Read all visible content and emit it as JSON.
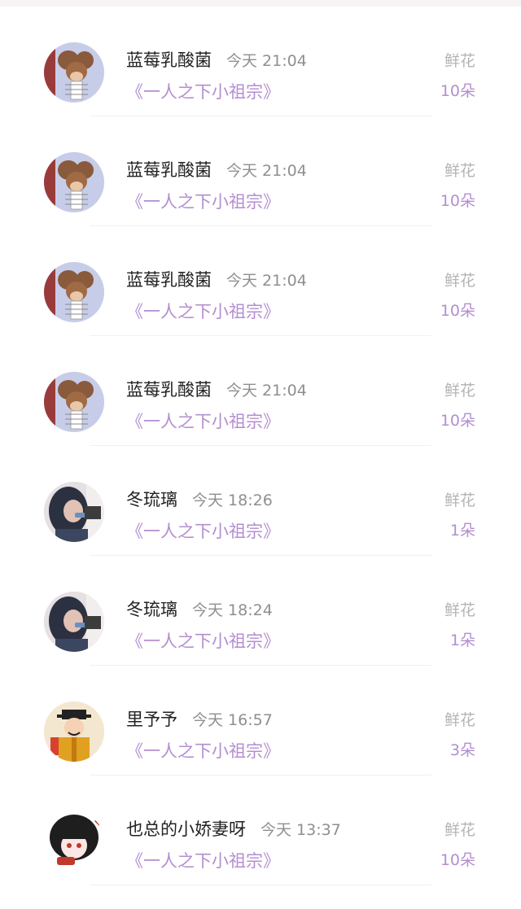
{
  "list": {
    "items": [
      {
        "name": "蓝莓乳酸菌",
        "time": "今天 21:04",
        "book": "《一人之下小祖宗》",
        "gift_label": "鲜花",
        "gift_count": "10朵",
        "avatar": "tom-and-jerry-mouse-avatar"
      },
      {
        "name": "蓝莓乳酸菌",
        "time": "今天 21:04",
        "book": "《一人之下小祖宗》",
        "gift_label": "鲜花",
        "gift_count": "10朵",
        "avatar": "tom-and-jerry-mouse-avatar"
      },
      {
        "name": "蓝莓乳酸菌",
        "time": "今天 21:04",
        "book": "《一人之下小祖宗》",
        "gift_label": "鲜花",
        "gift_count": "10朵",
        "avatar": "tom-and-jerry-mouse-avatar"
      },
      {
        "name": "蓝莓乳酸菌",
        "time": "今天 21:04",
        "book": "《一人之下小祖宗》",
        "gift_label": "鲜花",
        "gift_count": "10朵",
        "avatar": "tom-and-jerry-mouse-avatar"
      },
      {
        "name": "冬琉璃",
        "time": "今天 18:26",
        "book": "《一人之下小祖宗》",
        "gift_label": "鲜花",
        "gift_count": "1朵",
        "avatar": "girl-photo-avatar"
      },
      {
        "name": "冬琉璃",
        "time": "今天 18:24",
        "book": "《一人之下小祖宗》",
        "gift_label": "鲜花",
        "gift_count": "1朵",
        "avatar": "girl-photo-avatar"
      },
      {
        "name": "里予予",
        "time": "今天 16:57",
        "book": "《一人之下小祖宗》",
        "gift_label": "鲜花",
        "gift_count": "3朵",
        "avatar": "cartoon-official-avatar"
      },
      {
        "name": "也总的小娇妻呀",
        "time": "今天 13:37",
        "book": "《一人之下小祖宗》",
        "gift_label": "鲜花",
        "gift_count": "10朵",
        "avatar": "anime-girl-avatar"
      }
    ]
  },
  "colors": {
    "accent_purple": "#b38ed0",
    "muted_gray": "#b4b4b4",
    "name_text": "#222222"
  }
}
